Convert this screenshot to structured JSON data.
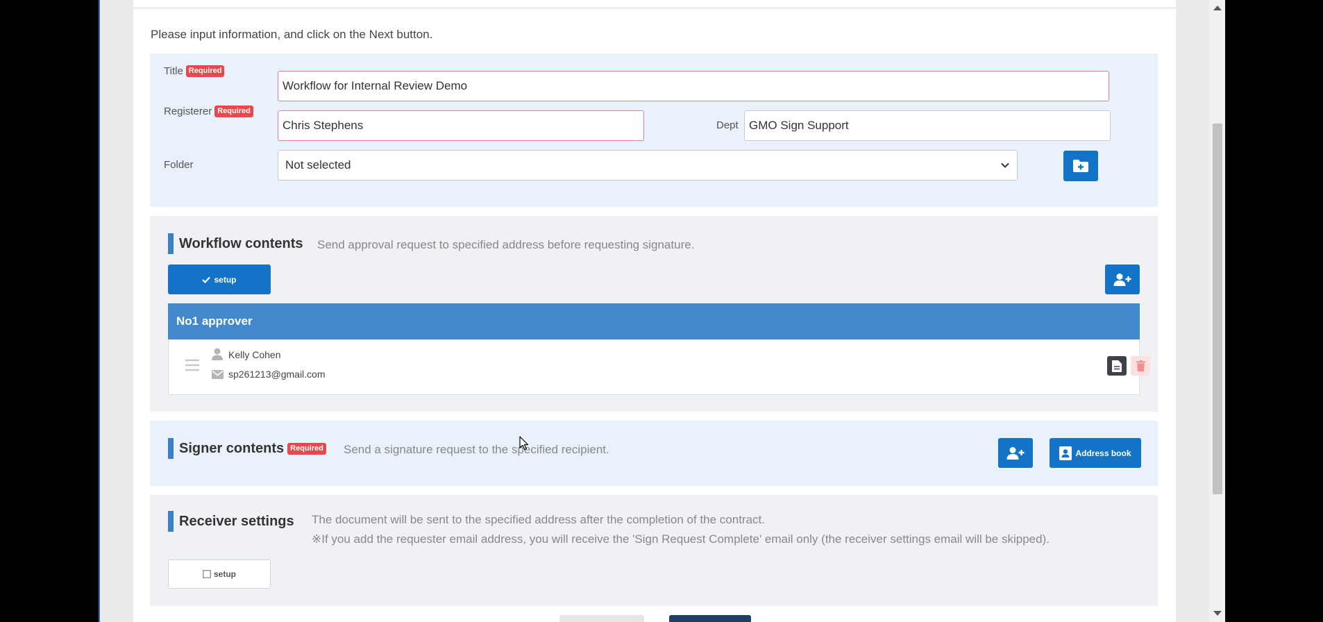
{
  "instruction": "Please input information, and click on the Next button.",
  "required_badge": "Required",
  "form": {
    "title_label": "Title",
    "title_value": "Workflow for Internal Review Demo",
    "registerer_label": "Registerer",
    "registerer_value": "Chris Stephens",
    "dept_label": "Dept",
    "dept_value": "GMO Sign Support",
    "folder_label": "Folder",
    "folder_value": "Not selected"
  },
  "workflow": {
    "title": "Workflow contents",
    "description": "Send approval request to specified address before requesting signature.",
    "setup_label": "setup",
    "approver_heading": "No1 approver",
    "approver_name": "Kelly Cohen",
    "approver_email": "sp261213@gmail.com"
  },
  "signer": {
    "title": "Signer contents",
    "description": "Send a signature request to the specified recipient.",
    "address_book_label": "Address book"
  },
  "receiver": {
    "title": "Receiver settings",
    "description_1": "The document will be sent to the specified address after the completion of the contract.",
    "description_2": "※If you add the requester email address, you will receive the 'Sign Request Complete' email only (the receiver settings email will be skipped).",
    "setup_label": "setup"
  },
  "colors": {
    "accent": "#1273c7",
    "header_blue": "#4189cc",
    "required_red": "#e8474b"
  }
}
